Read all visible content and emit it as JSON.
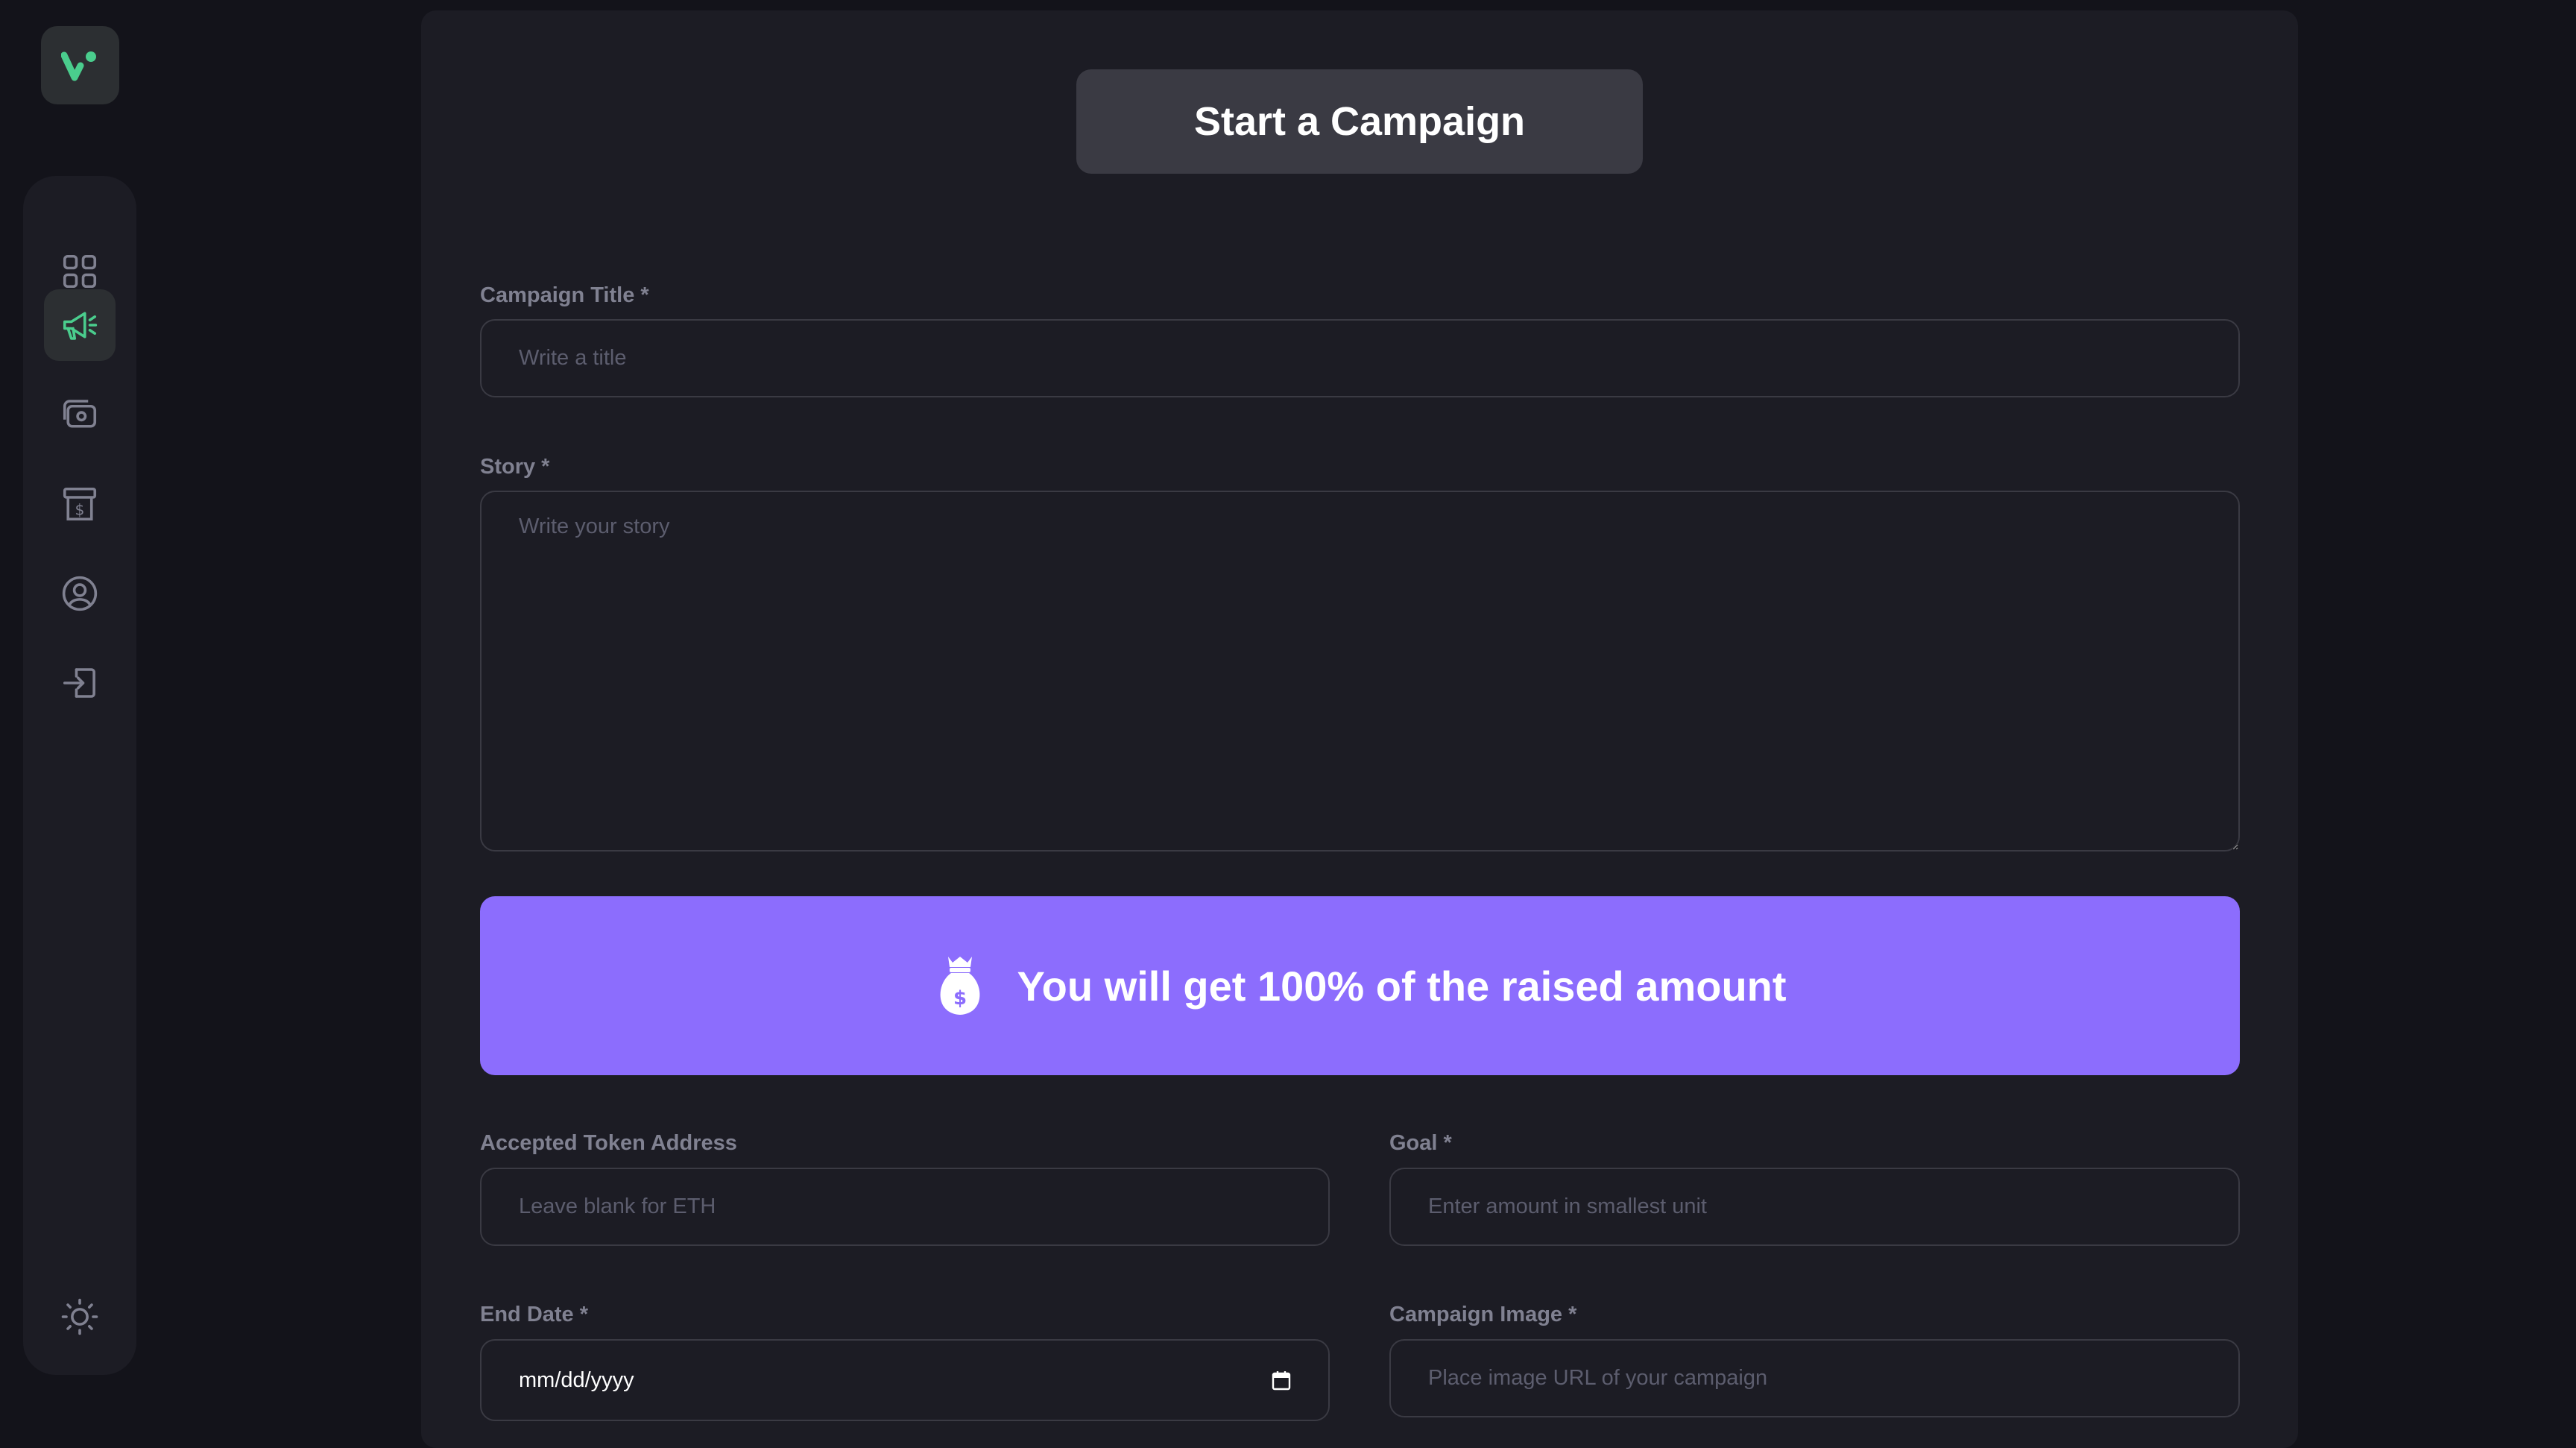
{
  "sidebar": {
    "items": [
      {
        "name": "dashboard",
        "icon": "dashboard-icon",
        "active": false
      },
      {
        "name": "campaign",
        "icon": "megaphone-icon",
        "active": true
      },
      {
        "name": "payment",
        "icon": "payment-icon",
        "active": false
      },
      {
        "name": "withdraw",
        "icon": "withdraw-icon",
        "active": false
      },
      {
        "name": "profile",
        "icon": "profile-icon",
        "active": false
      },
      {
        "name": "logout",
        "icon": "logout-icon",
        "active": false
      }
    ],
    "theme_icon": "sun-icon"
  },
  "header": {
    "title": "Start a Campaign"
  },
  "form": {
    "title_label": "Campaign Title *",
    "title_placeholder": "Write a title",
    "story_label": "Story *",
    "story_placeholder": "Write your story",
    "banner_text": "You will get 100% of the raised amount",
    "token_label": "Accepted Token Address",
    "token_placeholder": "Leave blank for ETH",
    "goal_label": "Goal *",
    "goal_placeholder": "Enter amount in smallest unit",
    "end_date_label": "End Date *",
    "end_date_value": "mm/dd/yyyy",
    "image_label": "Campaign Image *",
    "image_placeholder": "Place image URL of your campaign"
  },
  "colors": {
    "accent": "#8c6dfd",
    "brand_green": "#4acd8d",
    "background": "#13131a",
    "card": "#1c1c24"
  }
}
